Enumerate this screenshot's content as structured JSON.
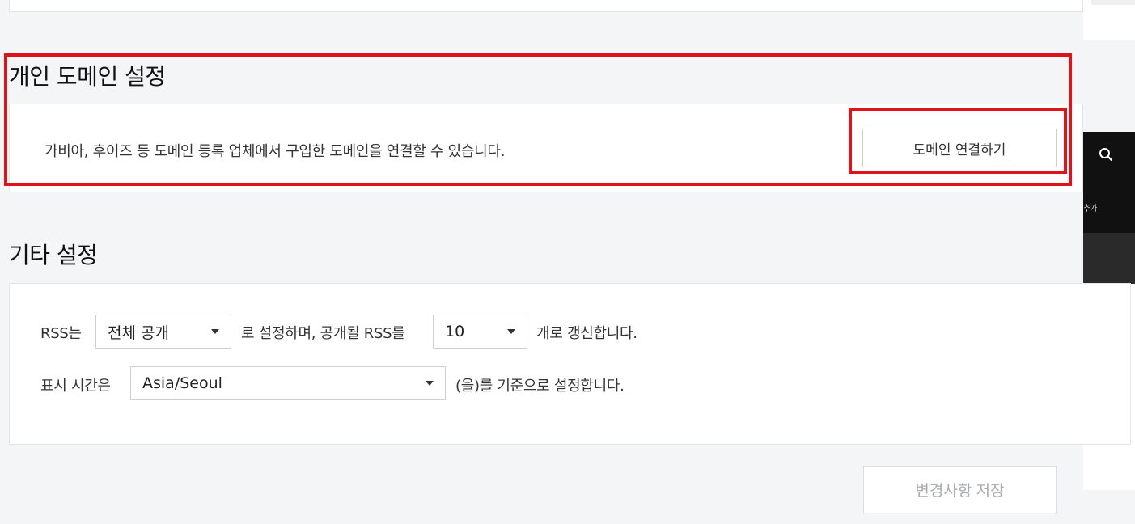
{
  "domain_section": {
    "title": "개인 도메인 설정",
    "description": "가비아, 후이즈 등 도메인 등록 업체에서 구입한 도메인을 연결할 수 있습니다.",
    "connect_button": "도메인 연결하기"
  },
  "etc_section": {
    "title": "기타 설정",
    "rss": {
      "label": "RSS는",
      "scope_value": "전체 공개",
      "middle_text": "로 설정하며, 공개될 RSS를",
      "count_value": "10",
      "tail_text": "개로 갱신합니다."
    },
    "timezone": {
      "label": "표시 시간은",
      "value": "Asia/Seoul",
      "tail_text": "(을)를 기준으로 설정합니다."
    }
  },
  "footer": {
    "save_button": "변경사항 저장"
  },
  "side_preview": {
    "partial_text": "추가",
    "icon": "search-icon"
  },
  "colors": {
    "highlight": "#e0121a",
    "background": "#f4f5f7"
  }
}
